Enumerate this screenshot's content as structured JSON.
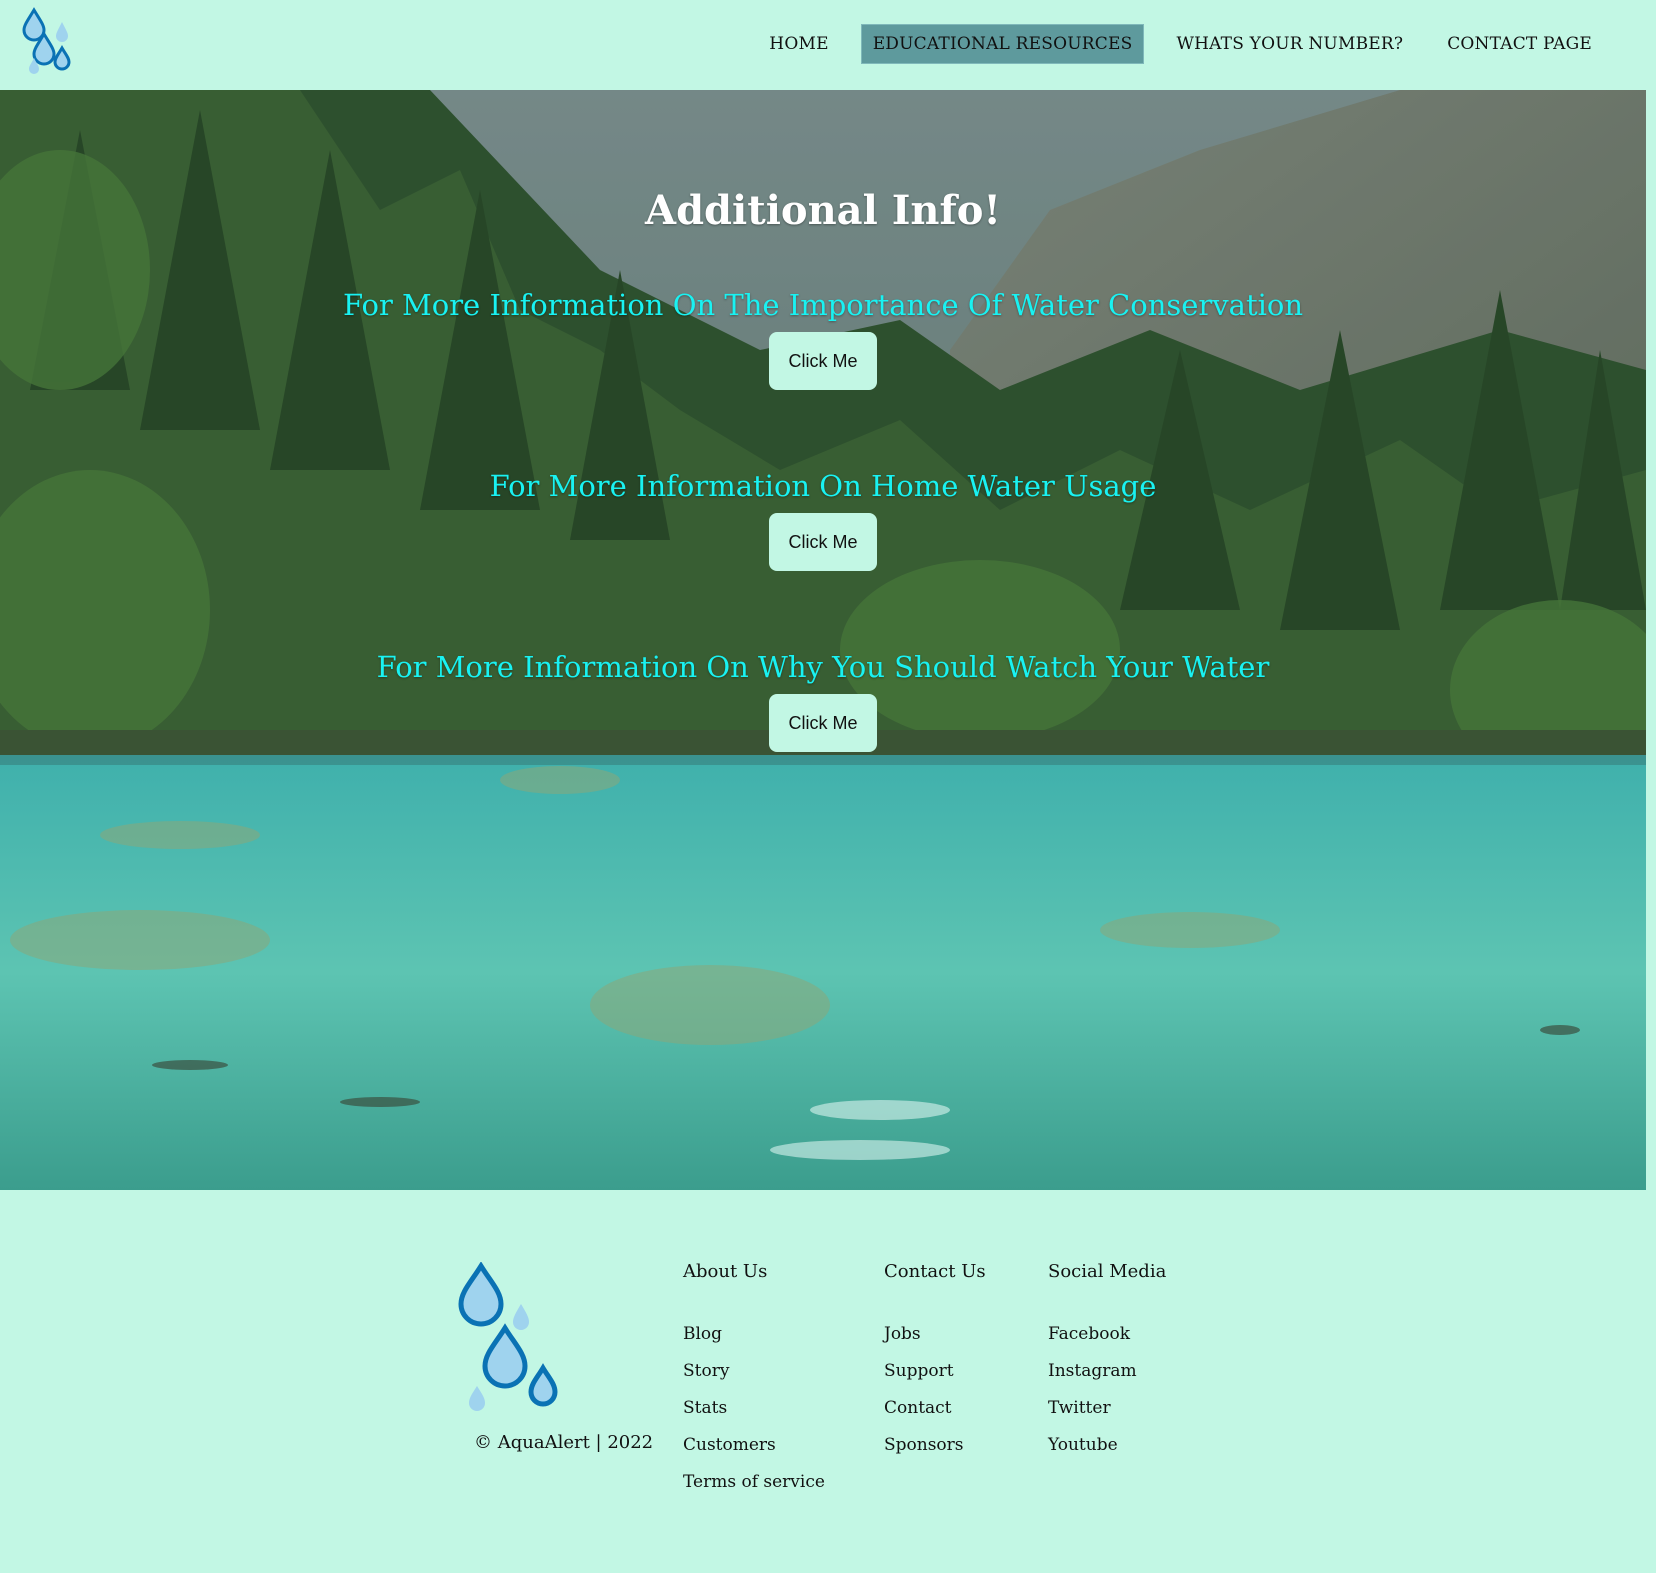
{
  "header": {
    "logo_icon": "water-drops-logo-icon",
    "nav": [
      {
        "label": "HOME",
        "active": false
      },
      {
        "label": "EDUCATIONAL RESOURCES",
        "active": true
      },
      {
        "label": "WHATS YOUR NUMBER?",
        "active": false
      },
      {
        "label": "CONTACT PAGE",
        "active": false
      }
    ]
  },
  "hero": {
    "title": "Additional Info!",
    "background": "forest-lake-photo",
    "sections": [
      {
        "heading": "For More Information On The Importance Of Water Conservation",
        "button": "Click Me"
      },
      {
        "heading": "For More Information On Home Water Usage",
        "button": "Click Me"
      },
      {
        "heading": "For More Information On Why You Should Watch Your Water",
        "button": "Click Me"
      }
    ]
  },
  "footer": {
    "logo_icon": "water-drops-logo-icon",
    "copyright": "© AquaAlert | 2022",
    "columns": [
      {
        "heading": "About Us",
        "links": [
          "Blog",
          "Story",
          "Stats",
          "Customers",
          "Terms of service"
        ]
      },
      {
        "heading": "Contact Us",
        "links": [
          "Jobs",
          "Support",
          "Contact",
          "Sponsors"
        ]
      },
      {
        "heading": "Social Media",
        "links": [
          "Facebook",
          "Instagram",
          "Twitter",
          "Youtube"
        ]
      }
    ]
  },
  "colors": {
    "page_bg": "#c2f7e4",
    "nav_active_bg": "#5e9a9d",
    "heading_cyan": "#19f2f2",
    "drop_dark": "#0a72b4",
    "drop_light": "#9fd3ee"
  }
}
